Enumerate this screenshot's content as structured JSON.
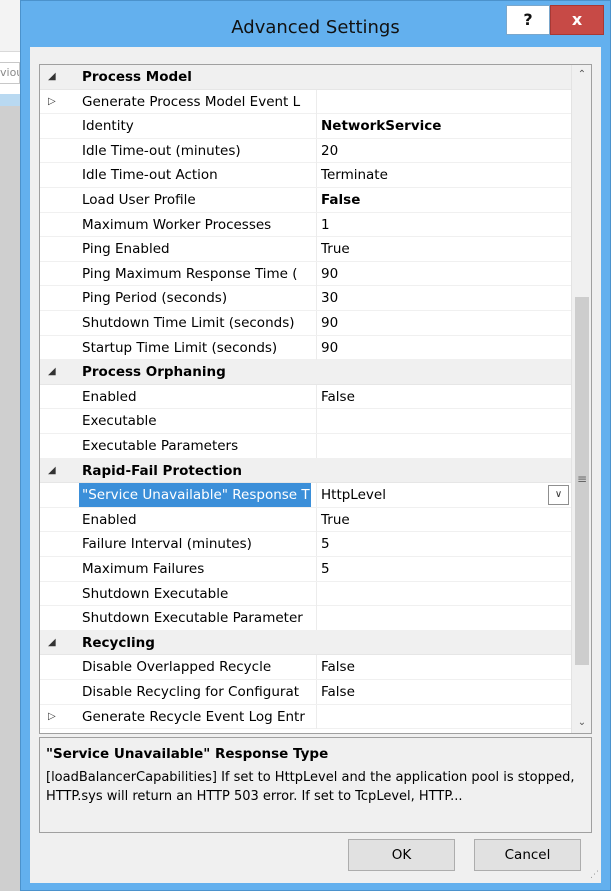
{
  "background": {
    "previous_label": "viou"
  },
  "dialog": {
    "title": "Advanced Settings",
    "help_label": "?",
    "close_label": "x"
  },
  "icons": {
    "expanded": "triangle-down-icon",
    "collapsed": "triangle-right-icon",
    "dropdown": "chevron-down-icon",
    "scroll_up": "chevron-up-icon",
    "scroll_down": "chevron-down-icon"
  },
  "grid": {
    "rows": [
      {
        "type": "category",
        "expander": "◢",
        "name": "Process Model"
      },
      {
        "type": "property",
        "expander": "▷",
        "name": "Generate Process Model Event L",
        "value": ""
      },
      {
        "type": "property",
        "name": "Identity",
        "value": "NetworkService",
        "bold": true
      },
      {
        "type": "property",
        "name": "Idle Time-out (minutes)",
        "value": "20"
      },
      {
        "type": "property",
        "name": "Idle Time-out Action",
        "value": "Terminate"
      },
      {
        "type": "property",
        "name": "Load User Profile",
        "value": "False",
        "bold": true
      },
      {
        "type": "property",
        "name": "Maximum Worker Processes",
        "value": "1"
      },
      {
        "type": "property",
        "name": "Ping Enabled",
        "value": "True"
      },
      {
        "type": "property",
        "name": "Ping Maximum Response Time (",
        "value": "90"
      },
      {
        "type": "property",
        "name": "Ping Period (seconds)",
        "value": "30"
      },
      {
        "type": "property",
        "name": "Shutdown Time Limit (seconds)",
        "value": "90"
      },
      {
        "type": "property",
        "name": "Startup Time Limit (seconds)",
        "value": "90"
      },
      {
        "type": "category",
        "expander": "◢",
        "name": "Process Orphaning"
      },
      {
        "type": "property",
        "name": "Enabled",
        "value": "False"
      },
      {
        "type": "property",
        "name": "Executable",
        "value": ""
      },
      {
        "type": "property",
        "name": "Executable Parameters",
        "value": ""
      },
      {
        "type": "category",
        "expander": "◢",
        "name": "Rapid-Fail Protection"
      },
      {
        "type": "property",
        "name": "\"Service Unavailable\" Response T",
        "value": "HttpLevel",
        "selected": true,
        "dropdown": true
      },
      {
        "type": "property",
        "name": "Enabled",
        "value": "True"
      },
      {
        "type": "property",
        "name": "Failure Interval (minutes)",
        "value": "5"
      },
      {
        "type": "property",
        "name": "Maximum Failures",
        "value": "5"
      },
      {
        "type": "property",
        "name": "Shutdown Executable",
        "value": ""
      },
      {
        "type": "property",
        "name": "Shutdown Executable Parameter",
        "value": ""
      },
      {
        "type": "category",
        "expander": "◢",
        "name": "Recycling"
      },
      {
        "type": "property",
        "name": "Disable Overlapped Recycle",
        "value": "False"
      },
      {
        "type": "property",
        "name": "Disable Recycling for Configurat",
        "value": "False"
      },
      {
        "type": "property",
        "expander": "▷",
        "name": "Generate Recycle Event Log Entr",
        "value": ""
      }
    ]
  },
  "description": {
    "title": "\"Service Unavailable\" Response Type",
    "text": "[loadBalancerCapabilities] If set to HttpLevel and the application pool is stopped, HTTP.sys will return an HTTP 503 error.  If set to TcpLevel, HTTP..."
  },
  "buttons": {
    "ok_label": "OK",
    "cancel_label": "Cancel"
  }
}
